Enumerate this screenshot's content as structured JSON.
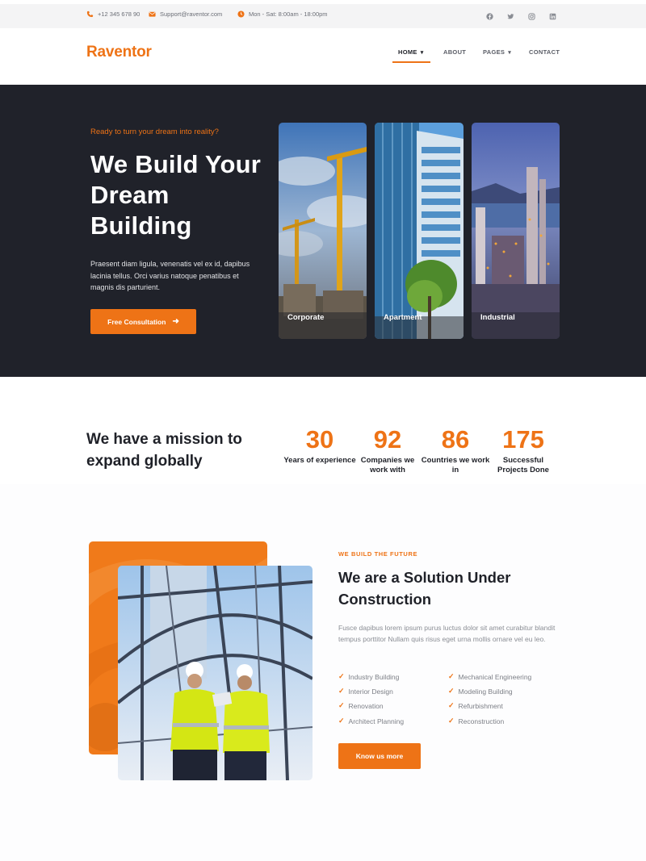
{
  "topbar": {
    "phone": "+12 345 678 90",
    "email": "Support@raventor.com",
    "hours": "Mon - Sat: 8:00am - 18:00pm"
  },
  "header": {
    "logo": "Raventor",
    "nav": [
      {
        "label": "HOME",
        "dropdown": true
      },
      {
        "label": "ABOUT",
        "dropdown": false
      },
      {
        "label": "PAGES",
        "dropdown": true
      },
      {
        "label": "CONTACT",
        "dropdown": false
      }
    ]
  },
  "hero": {
    "kicker": "Ready to turn your dream into reality?",
    "title": "We Build Your Dream Building",
    "text": "Praesent diam ligula, venenatis vel ex id, dapibus lacinia tellus. Orci varius natoque penatibus et magnis dis parturient.",
    "button": "Free Consultation",
    "cards": [
      {
        "label": "Corporate"
      },
      {
        "label": "Apartment"
      },
      {
        "label": "Industrial"
      }
    ]
  },
  "mission": {
    "title": "We have a mission to expand globally",
    "stats": [
      {
        "value": "30",
        "label": "Years of experience"
      },
      {
        "value": "92",
        "label": "Companies we work with"
      },
      {
        "value": "86",
        "label": "Countries we work in"
      },
      {
        "value": "175",
        "label": "Successful Projects Done"
      }
    ]
  },
  "about": {
    "kicker": "WE BUILD THE FUTURE",
    "title": "We are a Solution Under Construction",
    "text": "Fusce dapibus lorem ipsum purus luctus dolor sit amet curabitur blandit tempus porttitor Nullam quis risus eget urna mollis ornare vel eu leo.",
    "features_left": [
      "Industry Building",
      "Interior Design",
      "Renovation",
      "Architect Planning"
    ],
    "features_right": [
      "Mechanical Engineering",
      "Modeling Building",
      "Refurbishment",
      "Reconstruction"
    ],
    "button": "Know us more"
  },
  "colors": {
    "accent": "#ee7316",
    "dark": "#20222a"
  },
  "icons": {
    "social": [
      "facebook-icon",
      "twitter-icon",
      "instagram-icon",
      "linkedin-icon"
    ]
  }
}
